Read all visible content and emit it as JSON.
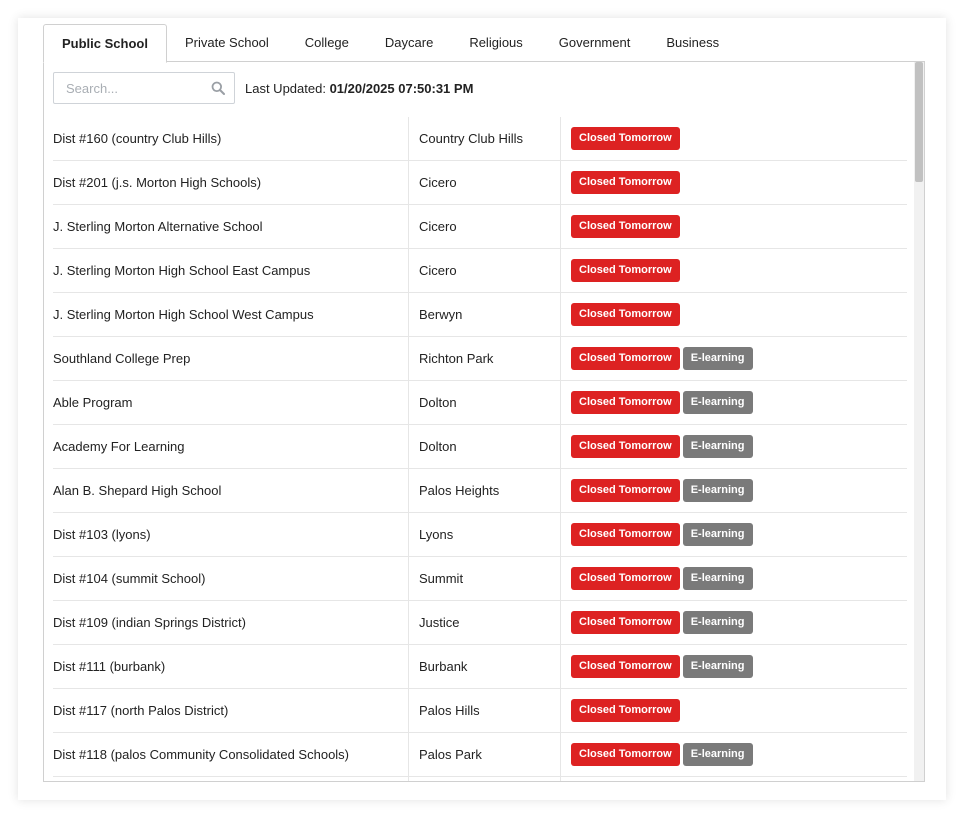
{
  "tabs": [
    {
      "label": "Public School",
      "active": true
    },
    {
      "label": "Private School",
      "active": false
    },
    {
      "label": "College",
      "active": false
    },
    {
      "label": "Daycare",
      "active": false
    },
    {
      "label": "Religious",
      "active": false
    },
    {
      "label": "Government",
      "active": false
    },
    {
      "label": "Business",
      "active": false
    }
  ],
  "search": {
    "placeholder": "Search...",
    "value": "",
    "icon": "search-icon"
  },
  "last_updated": {
    "label": "Last Updated:",
    "value": "01/20/2025 07:50:31 PM"
  },
  "badge_labels": {
    "closed": "Closed Tomorrow",
    "elearning": "E-learning"
  },
  "colors": {
    "closed": "#dd2222",
    "elearning": "#7a7a7a"
  },
  "rows": [
    {
      "name": "Dist #160 (country Club Hills)",
      "city": "Country Club Hills",
      "status": [
        "Closed Tomorrow"
      ]
    },
    {
      "name": "Dist #201 (j.s. Morton High Schools)",
      "city": "Cicero",
      "status": [
        "Closed Tomorrow"
      ]
    },
    {
      "name": "J. Sterling Morton Alternative School",
      "city": "Cicero",
      "status": [
        "Closed Tomorrow"
      ]
    },
    {
      "name": "J. Sterling Morton High School East Campus",
      "city": "Cicero",
      "status": [
        "Closed Tomorrow"
      ]
    },
    {
      "name": "J. Sterling Morton High School West Campus",
      "city": "Berwyn",
      "status": [
        "Closed Tomorrow"
      ]
    },
    {
      "name": "Southland College Prep",
      "city": "Richton Park",
      "status": [
        "Closed Tomorrow",
        "E-learning"
      ]
    },
    {
      "name": "Able Program",
      "city": "Dolton",
      "status": [
        "Closed Tomorrow",
        "E-learning"
      ]
    },
    {
      "name": "Academy For Learning",
      "city": "Dolton",
      "status": [
        "Closed Tomorrow",
        "E-learning"
      ]
    },
    {
      "name": "Alan B. Shepard High School",
      "city": "Palos Heights",
      "status": [
        "Closed Tomorrow",
        "E-learning"
      ]
    },
    {
      "name": "Dist #103 (lyons)",
      "city": "Lyons",
      "status": [
        "Closed Tomorrow",
        "E-learning"
      ]
    },
    {
      "name": "Dist #104 (summit School)",
      "city": "Summit",
      "status": [
        "Closed Tomorrow",
        "E-learning"
      ]
    },
    {
      "name": "Dist #109 (indian Springs District)",
      "city": "Justice",
      "status": [
        "Closed Tomorrow",
        "E-learning"
      ]
    },
    {
      "name": "Dist #111 (burbank)",
      "city": "Burbank",
      "status": [
        "Closed Tomorrow",
        "E-learning"
      ]
    },
    {
      "name": "Dist #117 (north Palos District)",
      "city": "Palos Hills",
      "status": [
        "Closed Tomorrow"
      ]
    },
    {
      "name": "Dist #118 (palos Community Consolidated Schools)",
      "city": "Palos Park",
      "status": [
        "Closed Tomorrow",
        "E-learning"
      ]
    },
    {
      "name": "",
      "city": "",
      "status": []
    }
  ]
}
